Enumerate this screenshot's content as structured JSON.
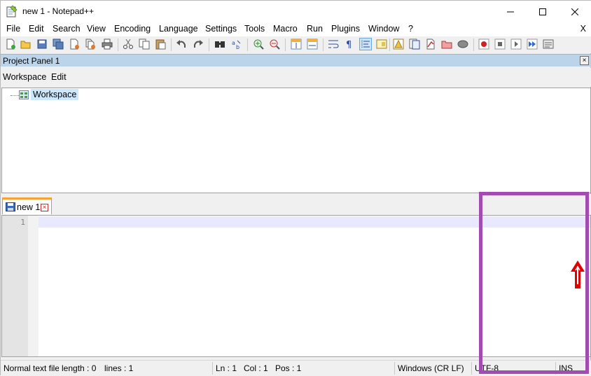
{
  "window": {
    "title": "new 1 - Notepad++"
  },
  "menu": {
    "items": [
      "File",
      "Edit",
      "Search",
      "View",
      "Encoding",
      "Language",
      "Settings",
      "Tools",
      "Macro",
      "Run",
      "Plugins",
      "Window",
      "?"
    ],
    "close_label": "X"
  },
  "toolbar": {
    "icons": [
      "new-file-icon",
      "open-file-icon",
      "save-icon",
      "save-all-icon",
      "close-icon",
      "close-all-icon",
      "print-icon",
      "cut-icon",
      "copy-icon",
      "paste-icon",
      "undo-icon",
      "redo-icon",
      "find-icon",
      "replace-icon",
      "zoom-in-icon",
      "zoom-out-icon",
      "sync-vertical-icon",
      "sync-horizontal-icon",
      "word-wrap-icon",
      "show-all-chars-icon",
      "indent-guide-icon",
      "doc-map-icon",
      "function-list-icon",
      "folder-workspace-icon",
      "document-list-icon",
      "project-panel-icon",
      "monitoring-icon",
      "record-macro-icon",
      "stop-macro-icon",
      "play-macro-icon",
      "run-macro-multiple-icon",
      "save-macro-icon"
    ]
  },
  "project_panel": {
    "title": "Project Panel 1",
    "close_symbol": "×",
    "menu": [
      "Workspace",
      "Edit"
    ],
    "tree_root": "Workspace"
  },
  "tabs": [
    {
      "label": "new 1",
      "close_symbol": "×"
    }
  ],
  "editor": {
    "line_numbers": [
      "1"
    ]
  },
  "statusbar": {
    "file_type": "Normal text file",
    "length": "length : 0",
    "lines": "lines : 1",
    "ln": "Ln : 1",
    "col": "Col : 1",
    "pos": "Pos : 1",
    "eol": "Windows (CR LF)",
    "encoding": "UTF-8",
    "mode": "INS"
  },
  "colors": {
    "highlight_box": "#a24bb0",
    "arrow": "#e00000",
    "tab_accent": "#f7a232",
    "panel_title": "#bcd4ea"
  }
}
